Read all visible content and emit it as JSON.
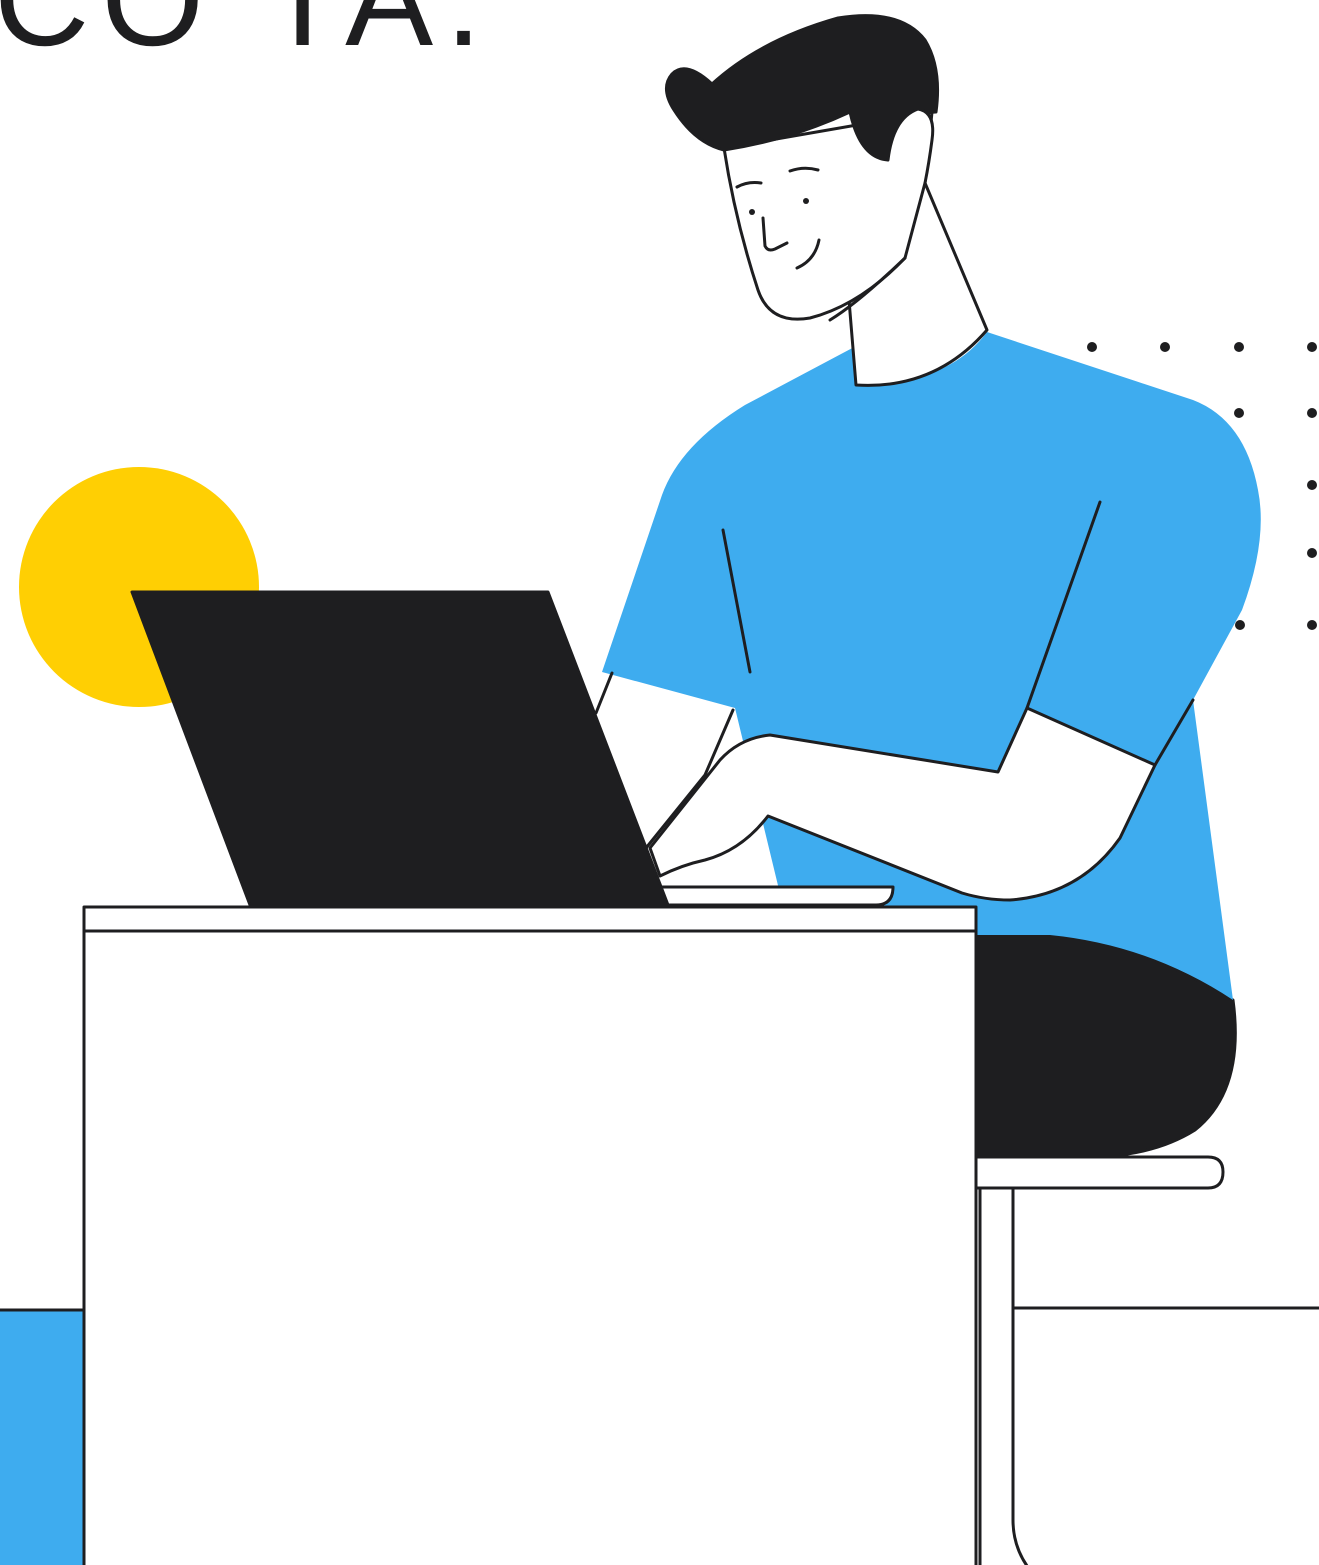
{
  "header_text": "CO TA.",
  "colors": {
    "ink": "#1e1e20",
    "shirt_blue": "#3eacef",
    "sun_yellow": "#ffcf03",
    "background": "#ffffff"
  },
  "icons": [
    "yellow-sun-circle",
    "dot-grid",
    "laptop",
    "desk",
    "stool",
    "person-typing"
  ]
}
